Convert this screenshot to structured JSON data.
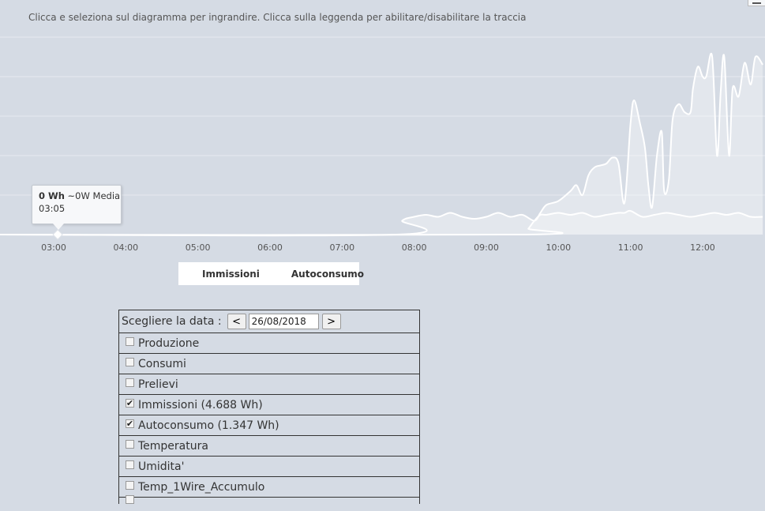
{
  "header": {
    "subtitle": "Clicca e seleziona sul diagramma per ingrandire. Clicca sulla leggenda per abilitare/disabilitare la traccia"
  },
  "chart_data": {
    "type": "area",
    "x_ticks": [
      "03:00",
      "04:00",
      "05:00",
      "06:00",
      "07:00",
      "08:00",
      "09:00",
      "10:00",
      "11:00",
      "12:00"
    ],
    "xlim": [
      "02:15",
      "12:50"
    ],
    "ylim": [
      0,
      5
    ],
    "grid": true,
    "series": [
      {
        "name": "Immissioni",
        "points": [
          [
            "02:15",
            0
          ],
          [
            "07:45",
            0
          ],
          [
            "07:50",
            0.35
          ],
          [
            "08:00",
            0.45
          ],
          [
            "08:10",
            0.5
          ],
          [
            "08:20",
            0.45
          ],
          [
            "08:30",
            0.55
          ],
          [
            "08:40",
            0.45
          ],
          [
            "08:50",
            0.4
          ],
          [
            "09:00",
            0.45
          ],
          [
            "09:10",
            0.55
          ],
          [
            "09:20",
            0.45
          ],
          [
            "09:30",
            0.5
          ],
          [
            "09:40",
            0.35
          ],
          [
            "09:45",
            0.55
          ],
          [
            "09:50",
            0.75
          ],
          [
            "10:00",
            0.85
          ],
          [
            "10:10",
            1.1
          ],
          [
            "10:15",
            1.25
          ],
          [
            "10:20",
            1.0
          ],
          [
            "10:25",
            1.5
          ],
          [
            "10:30",
            1.7
          ],
          [
            "10:35",
            1.75
          ],
          [
            "10:40",
            1.8
          ],
          [
            "10:45",
            1.95
          ],
          [
            "10:50",
            1.8
          ],
          [
            "10:55",
            0.8
          ],
          [
            "11:00",
            2.8
          ],
          [
            "11:03",
            3.4
          ],
          [
            "11:08",
            2.8
          ],
          [
            "11:12",
            2.2
          ],
          [
            "11:15",
            1.2
          ],
          [
            "11:18",
            0.7
          ],
          [
            "11:22",
            2.0
          ],
          [
            "11:26",
            2.6
          ],
          [
            "11:28",
            1.1
          ],
          [
            "11:32",
            1.4
          ],
          [
            "11:35",
            2.9
          ],
          [
            "11:40",
            3.3
          ],
          [
            "11:45",
            3.1
          ],
          [
            "11:50",
            3.1
          ],
          [
            "11:52",
            3.7
          ],
          [
            "11:56",
            4.25
          ],
          [
            "12:00",
            4.0
          ],
          [
            "12:03",
            4.0
          ],
          [
            "12:08",
            4.5
          ],
          [
            "12:12",
            2.0
          ],
          [
            "12:15",
            3.6
          ],
          [
            "12:18",
            4.5
          ],
          [
            "12:22",
            2.0
          ],
          [
            "12:25",
            3.7
          ],
          [
            "12:30",
            3.5
          ],
          [
            "12:35",
            4.35
          ],
          [
            "12:40",
            3.8
          ],
          [
            "12:44",
            4.5
          ],
          [
            "12:50",
            4.3
          ]
        ]
      },
      {
        "name": "Autoconsumo",
        "points": [
          [
            "02:15",
            0
          ],
          [
            "09:30",
            0
          ],
          [
            "09:35",
            0.15
          ],
          [
            "09:40",
            0.35
          ],
          [
            "09:45",
            0.5
          ],
          [
            "09:50",
            0.5
          ],
          [
            "10:00",
            0.55
          ],
          [
            "10:10",
            0.5
          ],
          [
            "10:20",
            0.55
          ],
          [
            "10:30",
            0.45
          ],
          [
            "10:40",
            0.5
          ],
          [
            "10:50",
            0.55
          ],
          [
            "10:55",
            0.55
          ],
          [
            "11:00",
            0.6
          ],
          [
            "11:10",
            0.45
          ],
          [
            "11:20",
            0.5
          ],
          [
            "11:30",
            0.55
          ],
          [
            "11:40",
            0.5
          ],
          [
            "11:50",
            0.45
          ],
          [
            "12:00",
            0.5
          ],
          [
            "12:10",
            0.55
          ],
          [
            "12:20",
            0.5
          ],
          [
            "12:30",
            0.55
          ],
          [
            "12:40",
            0.45
          ],
          [
            "12:50",
            0.45
          ]
        ]
      }
    ],
    "tooltip": {
      "value": "0 Wh",
      "detail": "~0W Media",
      "time": "03:05"
    }
  },
  "legend": {
    "items": [
      "Immissioni",
      "Autoconsumo"
    ]
  },
  "panel": {
    "date_label": "Scegliere la data :",
    "prev_label": "<",
    "next_label": ">",
    "date_value": "26/08/2018",
    "check_mark": "✔",
    "options": [
      {
        "label": "Produzione",
        "checked": false
      },
      {
        "label": "Consumi",
        "checked": false
      },
      {
        "label": "Prelievi",
        "checked": false
      },
      {
        "label": "Immissioni (4.688 Wh)",
        "checked": true
      },
      {
        "label": "Autoconsumo (1.347 Wh)",
        "checked": true
      },
      {
        "label": "Temperatura",
        "checked": false
      },
      {
        "label": "Umidita'",
        "checked": false
      },
      {
        "label": "Temp_1Wire_Accumulo",
        "checked": false
      }
    ]
  },
  "colors": {
    "background": "#d5dbe4",
    "series_line": "#ffffff",
    "grid": "#e6eaf0"
  }
}
